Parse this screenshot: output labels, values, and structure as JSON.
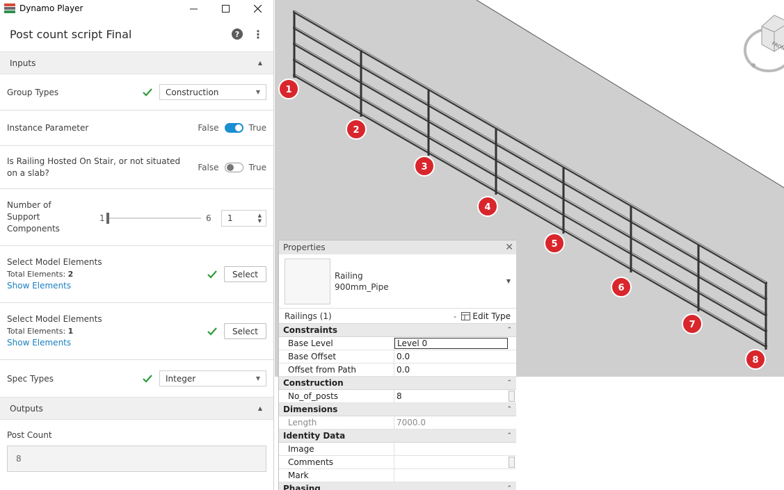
{
  "player": {
    "window_title": "Dynamo Player",
    "script_title": "Post count script Final",
    "inputs_label": "Inputs",
    "outputs_label": "Outputs",
    "group_types": {
      "label": "Group Types",
      "value": "Construction"
    },
    "instance_parameter": {
      "label": "Instance Parameter",
      "false_label": "False",
      "true_label": "True",
      "value": true
    },
    "hosted_on_stair": {
      "label": "Is Railing Hosted On Stair, or not situated on a slab?",
      "false_label": "False",
      "true_label": "True",
      "value": false
    },
    "support_components": {
      "label": "Number of Support Components",
      "min": "1",
      "max": "6",
      "value": "1"
    },
    "select_1": {
      "label": "Select Model Elements",
      "total_label": "Total Elements:",
      "total_value": "2",
      "show_link": "Show Elements",
      "button": "Select"
    },
    "select_2": {
      "label": "Select Model Elements",
      "total_label": "Total Elements:",
      "total_value": "1",
      "show_link": "Show Elements",
      "button": "Select"
    },
    "spec_types": {
      "label": "Spec Types",
      "value": "Integer"
    },
    "post_count": {
      "label": "Post Count",
      "value": "8"
    }
  },
  "viewport": {
    "post_markers": [
      "1",
      "2",
      "3",
      "4",
      "5",
      "6",
      "7",
      "8"
    ],
    "viewcube_label": "FRONT",
    "marker_color": "#d8262c"
  },
  "properties": {
    "title": "Properties",
    "family": "Railing",
    "type": "900mm_Pipe",
    "instance_filter": "Railings (1)",
    "edit_type": "Edit Type",
    "groups": {
      "constraints": "Constraints",
      "construction": "Construction",
      "dimensions": "Dimensions",
      "identity": "Identity Data",
      "phasing": "Phasing"
    },
    "rows": {
      "base_level": {
        "name": "Base Level",
        "value": "Level 0"
      },
      "base_offset": {
        "name": "Base Offset",
        "value": "0.0"
      },
      "offset_path": {
        "name": "Offset from Path",
        "value": "0.0"
      },
      "no_posts": {
        "name": "No_of_posts",
        "value": "8"
      },
      "length": {
        "name": "Length",
        "value": "7000.0"
      },
      "image": {
        "name": "Image",
        "value": ""
      },
      "comments": {
        "name": "Comments",
        "value": ""
      },
      "mark": {
        "name": "Mark",
        "value": ""
      }
    }
  }
}
